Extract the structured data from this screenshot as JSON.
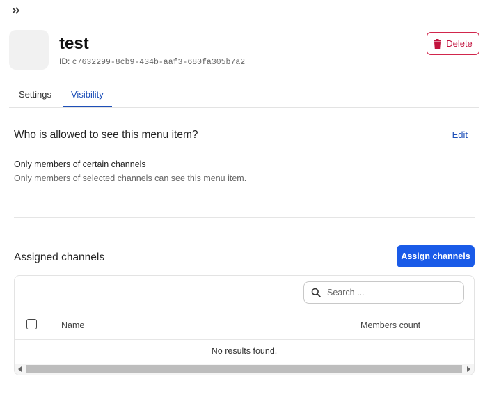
{
  "header": {
    "title": "test",
    "id_label": "ID:",
    "id_value": "c7632299-8cb9-434b-aaf3-680fa305b7a2",
    "delete_label": "Delete"
  },
  "tabs": [
    {
      "label": "Settings",
      "active": false
    },
    {
      "label": "Visibility",
      "active": true
    }
  ],
  "visibility": {
    "question": "Who is allowed to see this menu item?",
    "edit_label": "Edit",
    "option_title": "Only members of certain channels",
    "option_description": "Only members of selected channels can see this menu item."
  },
  "assigned": {
    "title": "Assigned channels",
    "assign_button": "Assign channels",
    "search_placeholder": "Search ...",
    "columns": [
      "Name",
      "Members count"
    ],
    "empty_text": "No results found."
  },
  "colors": {
    "accent": "#1a5be8",
    "tab_active": "#1d4fb8",
    "danger": "#c2123d"
  },
  "icons": [
    "double-chevron-right-icon",
    "trash-icon",
    "search-icon"
  ]
}
